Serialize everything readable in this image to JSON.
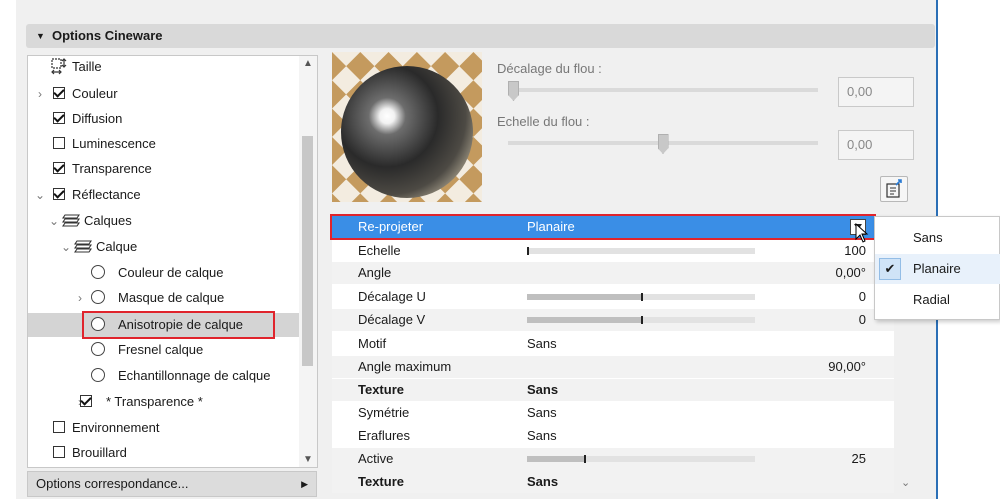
{
  "section": {
    "title": "Options Cineware"
  },
  "tree": {
    "items": [
      {
        "label": "Taille",
        "icon": "size-icon"
      },
      {
        "label": "Couleur",
        "checked": true,
        "expandable": true,
        "expanded": false
      },
      {
        "label": "Diffusion",
        "checked": true
      },
      {
        "label": "Luminescence",
        "checked": false
      },
      {
        "label": "Transparence",
        "checked": true
      },
      {
        "label": "Réflectance",
        "checked": true,
        "expandable": true,
        "expanded": true
      },
      {
        "label": "Calques",
        "icon": "layers-icon",
        "expandable": true,
        "expanded": true
      },
      {
        "label": "Calque",
        "icon": "layers-icon",
        "expandable": true,
        "expanded": true
      },
      {
        "label": "Couleur de calque",
        "icon": "radio-icon"
      },
      {
        "label": "Masque de calque",
        "icon": "radio-icon",
        "expandable": true,
        "expanded": false
      },
      {
        "label": "Anisotropie de calque",
        "icon": "radio-icon",
        "selected": true
      },
      {
        "label": "Fresnel calque",
        "icon": "radio-icon"
      },
      {
        "label": "Echantillonnage de calque",
        "icon": "radio-icon"
      },
      {
        "label": "* Transparence *",
        "checked": true,
        "expandable": true,
        "expanded": false
      },
      {
        "label": "Environnement",
        "checked": false
      },
      {
        "label": "Brouillard",
        "checked": false
      }
    ]
  },
  "options_bar": {
    "label": "Options correspondance..."
  },
  "blur": {
    "offset_label": "Décalage du flou :",
    "offset_value": "0,00",
    "offset_level": 0.0,
    "scale_label": "Echelle du flou :",
    "scale_value": "0,00",
    "scale_level": 0.5
  },
  "properties": {
    "rows": [
      {
        "name": "Re-projeter",
        "value": "Planaire",
        "selected": true
      },
      {
        "name": "Echelle",
        "rvalue": "100",
        "bar": 0.0
      },
      {
        "name": "Angle",
        "rvalue": "0,00°"
      },
      {
        "name": "Décalage U",
        "rvalue": "0",
        "bar": 0.5
      },
      {
        "name": "Décalage V",
        "rvalue": "0",
        "bar": 0.5
      },
      {
        "name": "Motif",
        "value": "Sans"
      },
      {
        "name": "Angle maximum",
        "rvalue": "90,00°"
      },
      {
        "name": "Texture",
        "value": "Sans",
        "bold": true
      },
      {
        "name": "Symétrie",
        "value": "Sans"
      },
      {
        "name": "Eraflures",
        "value": "Sans"
      },
      {
        "name": "Active",
        "rvalue": "25",
        "bar": 0.25
      },
      {
        "name": "Texture",
        "value": "Sans",
        "bold": true
      }
    ]
  },
  "dropdown": {
    "options": [
      {
        "label": "Sans",
        "checked": false
      },
      {
        "label": "Planaire",
        "checked": true
      },
      {
        "label": "Radial",
        "checked": false
      }
    ]
  },
  "colors": {
    "selection": "#3a8ee6",
    "highlight_border": "#e0242c",
    "frame": "#2b6fb6"
  }
}
